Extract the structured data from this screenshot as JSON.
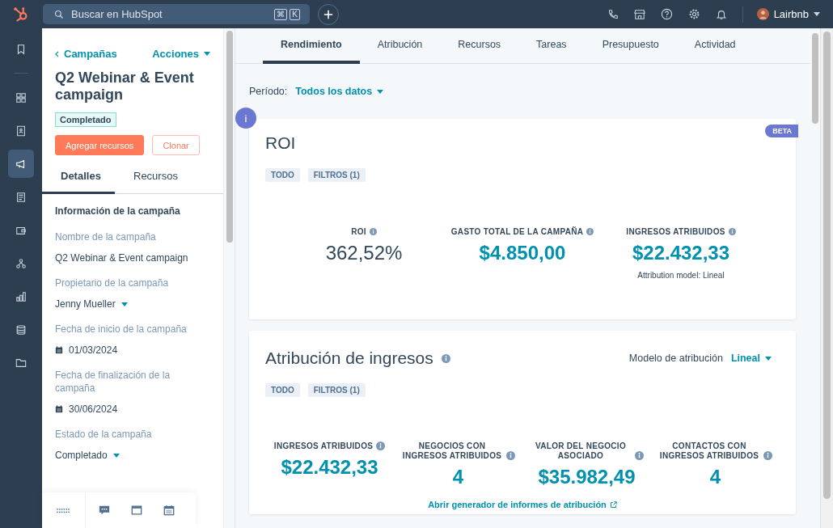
{
  "topbar": {
    "search": {
      "placeholder": "Buscar en HubSpot"
    },
    "shortcut_keys": [
      "⌘",
      "K"
    ],
    "user": "Lairbnb"
  },
  "rail": [
    {
      "kind": "bookmark",
      "selected": false
    },
    {
      "kind": "grid",
      "selected": false
    },
    {
      "kind": "contacts",
      "selected": false
    },
    {
      "kind": "megaphone",
      "selected": true
    },
    {
      "kind": "document",
      "selected": false
    },
    {
      "kind": "wallet",
      "selected": false
    },
    {
      "kind": "network",
      "selected": false
    },
    {
      "kind": "chart",
      "selected": false
    },
    {
      "kind": "database",
      "selected": false
    },
    {
      "kind": "folder",
      "selected": false
    }
  ],
  "panel": {
    "back_link": "Campañas",
    "actions": "Acciones",
    "title": "Q2 Webinar & Event campaign",
    "status": "Completado",
    "buttons": [
      {
        "label": "Agregar recursos",
        "kind": "primary"
      },
      {
        "label": "Clonar",
        "kind": "secondary"
      }
    ],
    "tabs": [
      {
        "label": "Detalles",
        "selected": true
      },
      {
        "label": "Recursos",
        "selected": false
      }
    ],
    "section_title": "Información de la campaña",
    "fields": [
      {
        "label": "Nombre de la campaña",
        "value": "Q2 Webinar & Event campaign",
        "kind": "text"
      },
      {
        "label": "Propietario de la campaña",
        "value": "Jenny Mueller",
        "kind": "dropdown"
      },
      {
        "label": "Fecha de inicio de la campaña",
        "value": "01/03/2024",
        "kind": "date"
      },
      {
        "label": "Fecha de finalización de la campaña",
        "value": "30/06/2024",
        "kind": "date"
      },
      {
        "label": "Estado de la campaña",
        "value": "Completado",
        "kind": "dropdown"
      }
    ]
  },
  "main": {
    "tabs": [
      {
        "label": "Rendimiento",
        "selected": true
      },
      {
        "label": "Atribución",
        "selected": false
      },
      {
        "label": "Recursos",
        "selected": false
      },
      {
        "label": "Tareas",
        "selected": false
      },
      {
        "label": "Presupuesto",
        "selected": false
      },
      {
        "label": "Actividad",
        "selected": false
      }
    ],
    "period_label": "Período:",
    "period_value": "Todos los datos",
    "info_button": "i",
    "roi_card": {
      "title": "ROI",
      "badge": "BETA",
      "filters": [
        "TODO",
        "FILTROS (1)"
      ],
      "metrics": [
        {
          "label": "ROI",
          "value": "362,52%",
          "kind": "plain"
        },
        {
          "label": "GASTO TOTAL DE LA CAMPAÑA",
          "value": "$4.850,00",
          "kind": "accent"
        },
        {
          "label": "INGRESOS ATRIBUIDOS",
          "value": "$22.432,33",
          "kind": "accent",
          "note": "Attribution model: Lineal"
        }
      ]
    },
    "attribution_card": {
      "title": "Atribución de ingresos",
      "model_label": "Modelo de atribución",
      "model_value": "Lineal",
      "filters": [
        "TODO",
        "FILTROS (1)"
      ],
      "metrics": [
        {
          "label": "INGRESOS ATRIBUIDOS",
          "value": "$22.432,33",
          "kind": "accent"
        },
        {
          "label": "NEGOCIOS CON INGRESOS ATRIBUIDOS",
          "value": "4",
          "kind": "accent"
        },
        {
          "label": "VALOR DEL NEGOCIO ASOCIADO",
          "value": "$35.982,49",
          "kind": "accent"
        },
        {
          "label": "CONTACTOS CON INGRESOS ATRIBUIDOS",
          "value": "4",
          "kind": "accent"
        }
      ],
      "link": "Abrir generador de informes de atribución"
    }
  }
}
